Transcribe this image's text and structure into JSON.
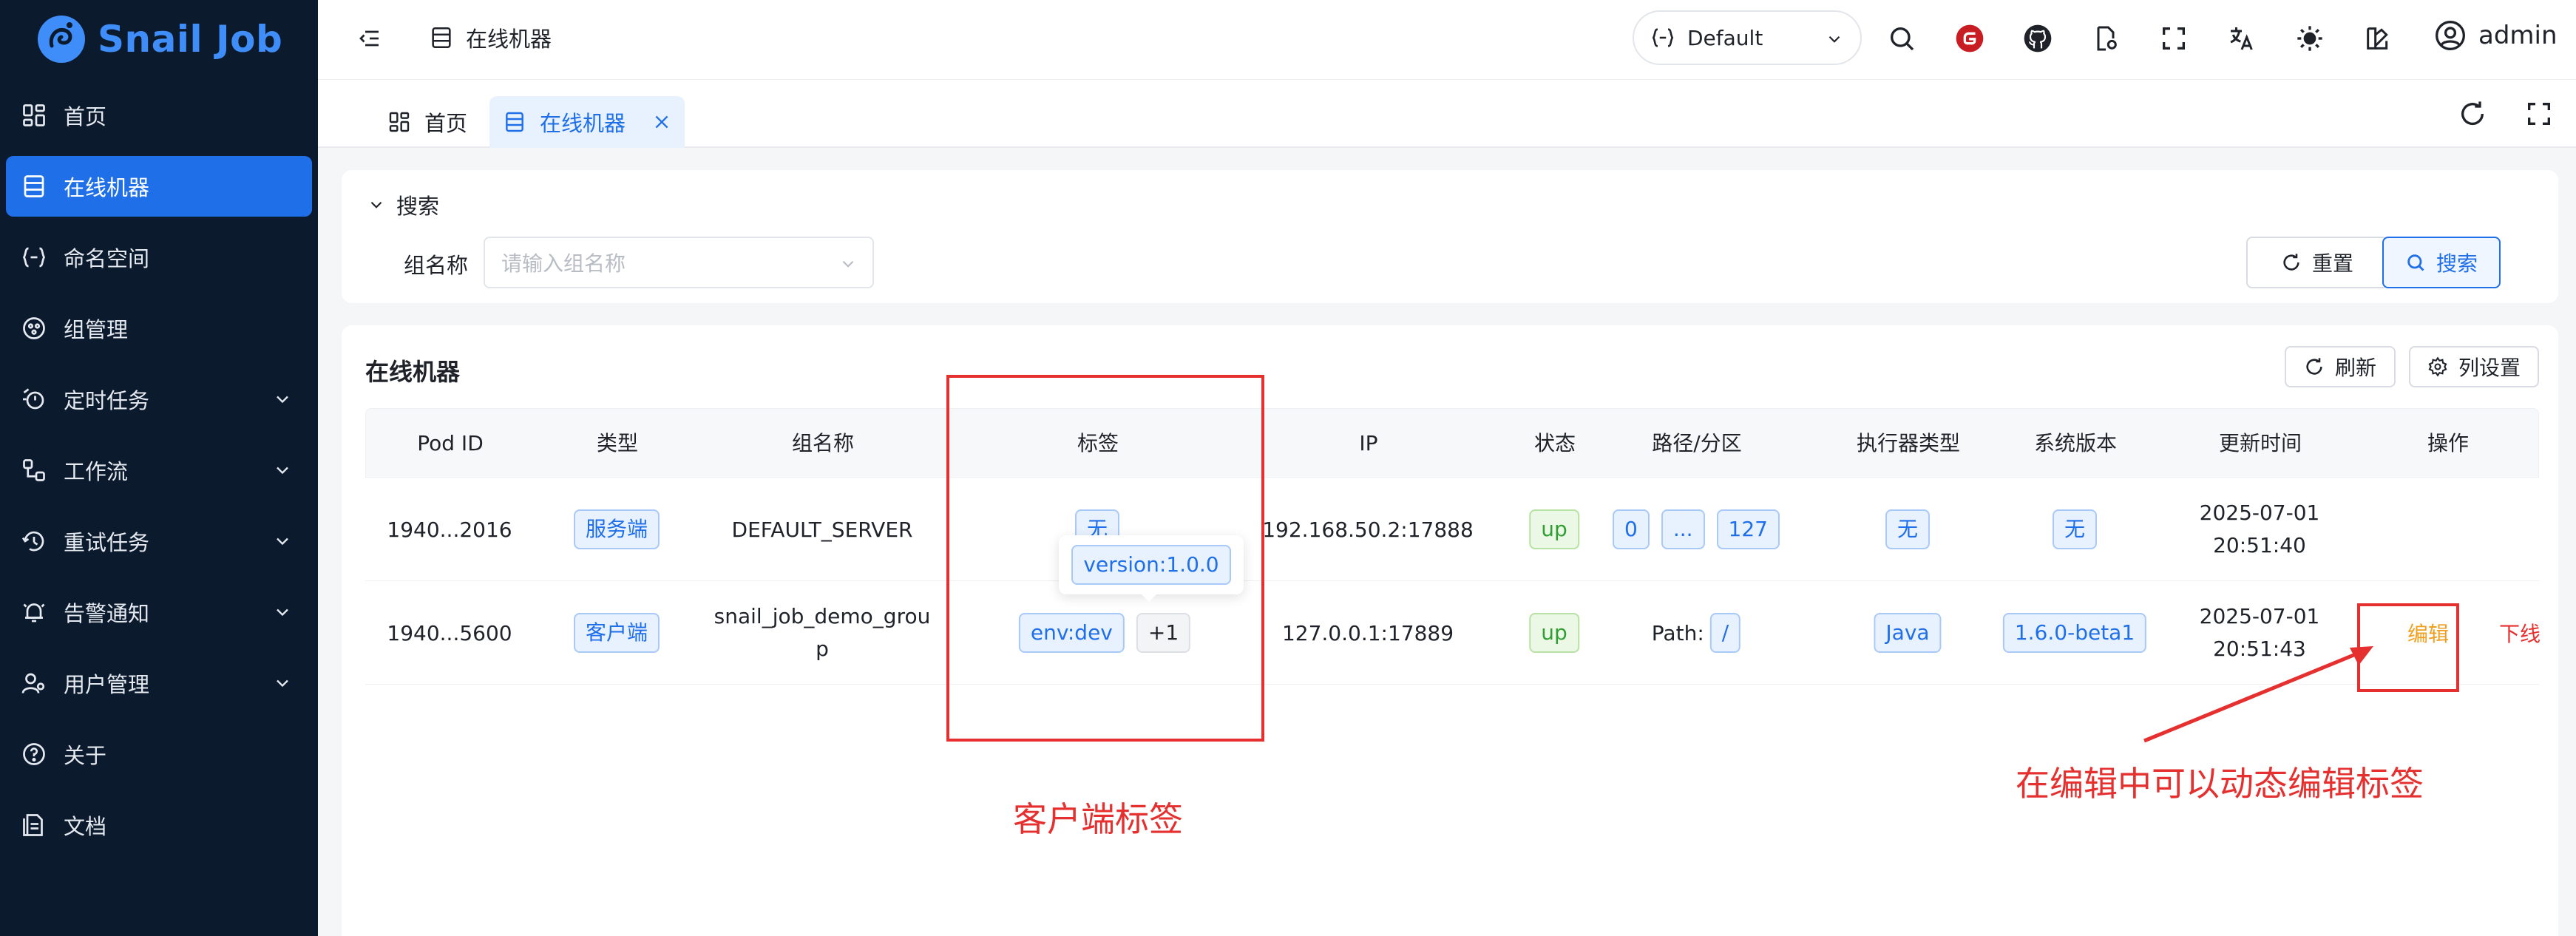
{
  "app": {
    "logo_text": "Snail Job"
  },
  "sidebar": {
    "items": [
      {
        "label": "首页",
        "icon": "dashboard-icon",
        "has_children": false
      },
      {
        "label": "在线机器",
        "icon": "server-icon",
        "active": true,
        "has_children": false
      },
      {
        "label": "命名空间",
        "icon": "namespace-icon",
        "has_children": false
      },
      {
        "label": "组管理",
        "icon": "group-icon",
        "has_children": false
      },
      {
        "label": "定时任务",
        "icon": "timer-task-icon",
        "has_children": true
      },
      {
        "label": "工作流",
        "icon": "workflow-icon",
        "has_children": true
      },
      {
        "label": "重试任务",
        "icon": "retry-icon",
        "has_children": true
      },
      {
        "label": "告警通知",
        "icon": "alarm-icon",
        "has_children": true
      },
      {
        "label": "用户管理",
        "icon": "user-manage-icon",
        "has_children": true
      },
      {
        "label": "关于",
        "icon": "help-icon",
        "has_children": false
      },
      {
        "label": "文档",
        "icon": "document-icon",
        "has_children": false
      }
    ]
  },
  "header": {
    "breadcrumb": "在线机器",
    "namespace_value": "Default",
    "user_name": "admin"
  },
  "tabs": [
    {
      "label": "首页",
      "icon": "dashboard-icon",
      "active": false
    },
    {
      "label": "在线机器",
      "icon": "server-icon",
      "active": true,
      "closable": true
    }
  ],
  "search": {
    "title": "搜索",
    "group_label": "组名称",
    "group_placeholder": "请输入组名称",
    "reset_label": "重置",
    "search_label": "搜索"
  },
  "table": {
    "title": "在线机器",
    "refresh_label": "刷新",
    "columns_label": "列设置",
    "headers": [
      "Pod ID",
      "类型",
      "组名称",
      "标签",
      "IP",
      "状态",
      "路径/分区",
      "执行器类型",
      "系统版本",
      "更新时间",
      "操作"
    ],
    "rows": [
      {
        "pod_id": "1940...2016",
        "type": "服务端",
        "group": "DEFAULT_SERVER",
        "label_tag": "无",
        "ip": "192.168.50.2:17888",
        "status": "up",
        "path_tags": [
          "0",
          "...",
          "127"
        ],
        "executor": "无",
        "version": "无",
        "date": "2025-07-01",
        "time": "20:51:40"
      },
      {
        "pod_id": "1940...5600",
        "type": "客户端",
        "group_line1": "snail_job_demo_grou",
        "group_line2": "p",
        "label_tag": "env:dev",
        "label_more": "+1",
        "ip": "127.0.0.1:17889",
        "status": "up",
        "path_prefix": "Path:",
        "path_tag": "/",
        "executor": "Java",
        "version": "1.6.0-beta1",
        "date": "2025-07-01",
        "time": "20:51:43",
        "edit_label": "编辑",
        "offline_label": "下线"
      }
    ],
    "tooltip": "version:1.0.0"
  },
  "annotations": {
    "client_label": "客户端标签",
    "edit_hint": "在编辑中可以动态编辑标签",
    "color": "#e5302f"
  },
  "colors": {
    "sidebar_bg": "#0c1a2e",
    "accent": "#1f6fe8",
    "success": "#2f9e33",
    "warning": "#f0a020",
    "danger": "#e5302f"
  }
}
